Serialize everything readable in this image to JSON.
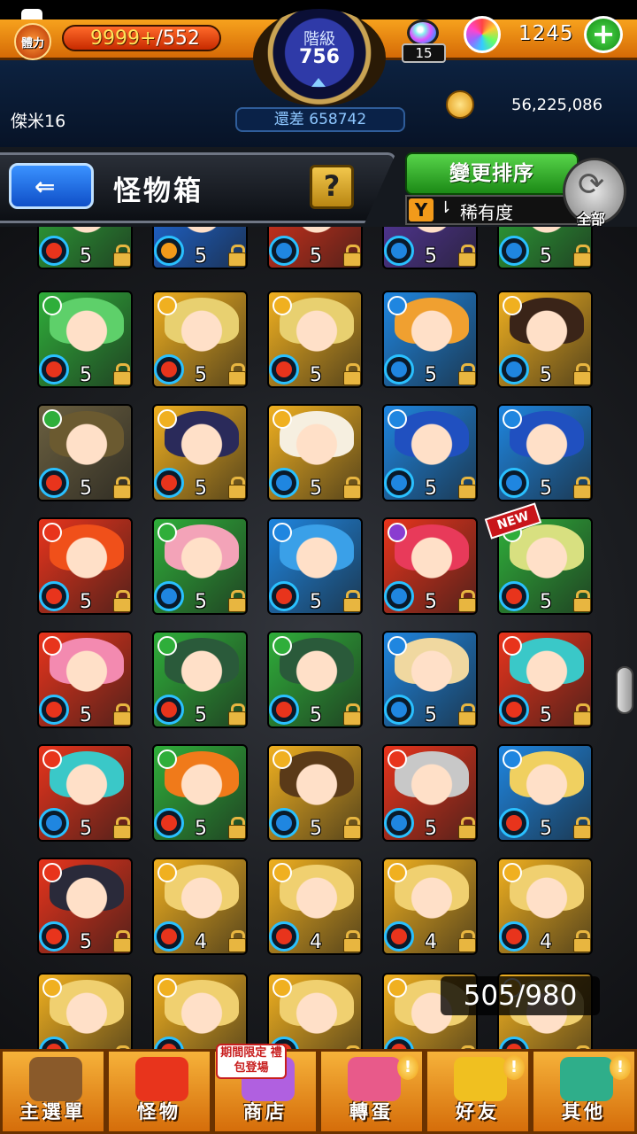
{
  "status": {
    "player": {
      "stamina_label": "體力",
      "stamina_current": "9999+",
      "stamina_max": "/552",
      "name": "傑米16"
    },
    "rank": {
      "label": "階級",
      "value": "756",
      "exp_remaining": "還差 658742"
    },
    "gacha_tickets": "15",
    "orb_count": "1245",
    "coins": "56,225,086"
  },
  "titlebar": {
    "back_icon": "back-arrow-icon",
    "title": "怪物箱",
    "help_label": "?",
    "sort_button": "變更排序",
    "sort_by": "稀有度",
    "all_label": "全部"
  },
  "box_count": "505/980",
  "new_badge": "NEW",
  "colors": {
    "accent_orange": "#f29a1a",
    "green": "#3fbf2f",
    "blue": "#1f6fe8",
    "fire": "#e8341c",
    "water": "#1f86e0",
    "wood": "#2fae3a",
    "light": "#f0b020",
    "dark": "#8a3cd0"
  },
  "monsters": [
    {
      "lvl": "5",
      "bg": "#2fae3a",
      "hair": "#9ee07a",
      "elem": "#e8341c",
      "attr": "#2fae3a"
    },
    {
      "lvl": "5",
      "bg": "#1f6fe8",
      "hair": "#6b4ad0",
      "elem": "#f29a1a",
      "attr": "#1f86e0"
    },
    {
      "lvl": "5",
      "bg": "#e8341c",
      "hair": "#f6efe0",
      "elem": "#1f86e0",
      "attr": "#e8341c"
    },
    {
      "lvl": "5",
      "bg": "#5a3aa8",
      "hair": "#7a5ac8",
      "elem": "#1f86e0",
      "attr": "#8a3cd0"
    },
    {
      "lvl": "5",
      "bg": "#2fae3a",
      "hair": "#c8e87a",
      "elem": "#1f86e0",
      "attr": "#2fae3a"
    },
    {
      "lvl": "5",
      "bg": "#2fae3a",
      "hair": "#5ed06a",
      "elem": "#e8341c",
      "attr": "#2fae3a"
    },
    {
      "lvl": "5",
      "bg": "#f0b020",
      "hair": "#e8d070",
      "elem": "#e8341c",
      "attr": "#f0b020"
    },
    {
      "lvl": "5",
      "bg": "#f0b020",
      "hair": "#e8d070",
      "elem": "#e8341c",
      "attr": "#f0b020"
    },
    {
      "lvl": "5",
      "bg": "#1f86e0",
      "hair": "#f0a030",
      "elem": "#1f86e0",
      "attr": "#1f86e0"
    },
    {
      "lvl": "5",
      "bg": "#f0b020",
      "hair": "#3a2418",
      "elem": "#1f86e0",
      "attr": "#f0b020"
    },
    {
      "lvl": "5",
      "bg": "#6b6040",
      "hair": "#6b5a30",
      "elem": "#e8341c",
      "attr": "#2fae3a"
    },
    {
      "lvl": "5",
      "bg": "#f0b020",
      "hair": "#2a2a5a",
      "elem": "#e8341c",
      "attr": "#f0b020"
    },
    {
      "lvl": "5",
      "bg": "#f0b020",
      "hair": "#f6efe0",
      "elem": "#1f86e0",
      "attr": "#f0b020"
    },
    {
      "lvl": "5",
      "bg": "#1f86e0",
      "hair": "#2050c0",
      "elem": "#1f86e0",
      "attr": "#1f86e0"
    },
    {
      "lvl": "5",
      "bg": "#1f86e0",
      "hair": "#2050c0",
      "elem": "#1f86e0",
      "attr": "#1f86e0"
    },
    {
      "lvl": "5",
      "bg": "#e8341c",
      "hair": "#f0501a",
      "elem": "#e8341c",
      "attr": "#e8341c"
    },
    {
      "lvl": "5",
      "bg": "#2fae3a",
      "hair": "#f3a3b8",
      "elem": "#1f86e0",
      "attr": "#2fae3a"
    },
    {
      "lvl": "5",
      "bg": "#1f86e0",
      "hair": "#3aa0e8",
      "elem": "#e8341c",
      "attr": "#1f86e0"
    },
    {
      "lvl": "5",
      "bg": "#e8341c",
      "hair": "#e83a5a",
      "elem": "#1f86e0",
      "attr": "#8a3cd0"
    },
    {
      "lvl": "5",
      "bg": "#2fae3a",
      "hair": "#d8e080",
      "elem": "#e8341c",
      "attr": "#2fae3a"
    },
    {
      "lvl": "5",
      "bg": "#e8341c",
      "hair": "#f38ab0",
      "elem": "#e8341c",
      "attr": "#e8341c"
    },
    {
      "lvl": "5",
      "bg": "#2fae3a",
      "hair": "#2a5a3a",
      "elem": "#e8341c",
      "attr": "#2fae3a"
    },
    {
      "lvl": "5",
      "bg": "#2fae3a",
      "hair": "#2a5a3a",
      "elem": "#e8341c",
      "attr": "#2fae3a"
    },
    {
      "lvl": "5",
      "bg": "#1f86e0",
      "hair": "#f0d8a0",
      "elem": "#1f86e0",
      "attr": "#1f86e0"
    },
    {
      "lvl": "5",
      "bg": "#e8341c",
      "hair": "#3ac8c8",
      "elem": "#e8341c",
      "attr": "#e8341c"
    },
    {
      "lvl": "5",
      "bg": "#e8341c",
      "hair": "#3ac8c8",
      "elem": "#1f86e0",
      "attr": "#e8341c"
    },
    {
      "lvl": "5",
      "bg": "#2fae3a",
      "hair": "#f07a1a",
      "elem": "#e8341c",
      "attr": "#2fae3a"
    },
    {
      "lvl": "5",
      "bg": "#f0b020",
      "hair": "#5a3a18",
      "elem": "#1f86e0",
      "attr": "#f0b020"
    },
    {
      "lvl": "5",
      "bg": "#e8341c",
      "hair": "#c8c8c8",
      "elem": "#1f86e0",
      "attr": "#e8341c"
    },
    {
      "lvl": "5",
      "bg": "#1f86e0",
      "hair": "#f0d060",
      "elem": "#e8341c",
      "attr": "#1f86e0"
    },
    {
      "lvl": "5",
      "bg": "#e8341c",
      "hair": "#2a2a3a",
      "elem": "#e8341c",
      "attr": "#e8341c"
    },
    {
      "lvl": "4",
      "bg": "#f0b020",
      "hair": "#f0d070",
      "elem": "#e8341c",
      "attr": "#f0b020"
    },
    {
      "lvl": "4",
      "bg": "#f0b020",
      "hair": "#f0d070",
      "elem": "#e8341c",
      "attr": "#f0b020"
    },
    {
      "lvl": "4",
      "bg": "#f0b020",
      "hair": "#f0d070",
      "elem": "#e8341c",
      "attr": "#f0b020"
    },
    {
      "lvl": "4",
      "bg": "#f0b020",
      "hair": "#f0d070",
      "elem": "#e8341c",
      "attr": "#f0b020"
    },
    {
      "lvl": "",
      "bg": "#f0b020",
      "hair": "#f0d070",
      "elem": "#e8341c",
      "attr": "#f0b020"
    },
    {
      "lvl": "",
      "bg": "#f0b020",
      "hair": "#f0d070",
      "elem": "#e8341c",
      "attr": "#f0b020"
    },
    {
      "lvl": "",
      "bg": "#f0b020",
      "hair": "#f0d070",
      "elem": "#e8341c",
      "attr": "#f0b020"
    },
    {
      "lvl": "",
      "bg": "#f0b020",
      "hair": "#f0d070",
      "elem": "#e8341c",
      "attr": "#f0b020"
    },
    {
      "lvl": "",
      "bg": "#f0b020",
      "hair": "#f0d070",
      "elem": "#e8341c",
      "attr": "#f0b020"
    }
  ],
  "bottom_nav": [
    {
      "label": "主選單",
      "icon": "castle-icon",
      "color": "#8a5a2a",
      "alert": ""
    },
    {
      "label": "怪物",
      "icon": "monster-icon",
      "color": "#e8341c",
      "alert": ""
    },
    {
      "label": "商店",
      "icon": "orb-shop-icon",
      "color": "#b060e0",
      "alert": ""
    },
    {
      "label": "轉蛋",
      "icon": "gacha-icon",
      "color": "#e85a8a",
      "alert": "!"
    },
    {
      "label": "好友",
      "icon": "friends-icon",
      "color": "#f0c020",
      "alert": "!"
    },
    {
      "label": "其他",
      "icon": "question-icon",
      "color": "#2fae8a",
      "alert": "!"
    }
  ],
  "promo": "期間限定 禮包登場"
}
